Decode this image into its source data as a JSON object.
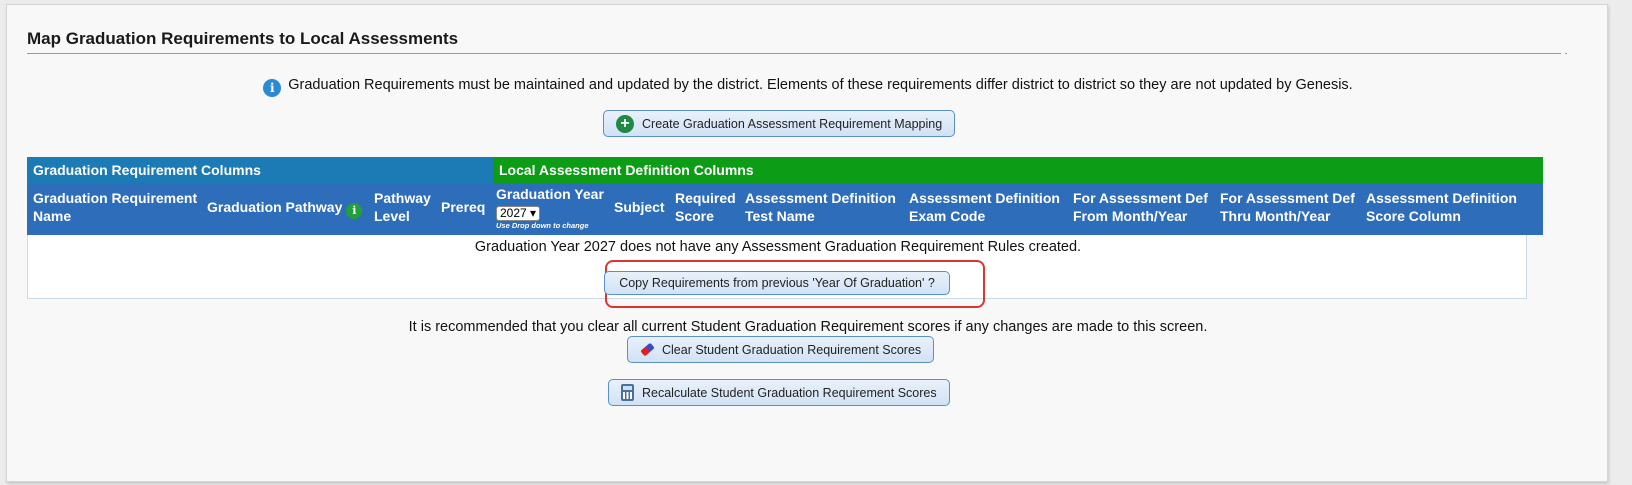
{
  "page": {
    "title": "Map Graduation Requirements to Local Assessments",
    "info_text": "Graduation Requirements must be maintained and updated by the district. Elements of these requirements differ district to district so they are not updated by Genesis."
  },
  "actions": {
    "create_mapping_label": "Create Graduation Assessment Requirement Mapping",
    "copy_requirements_label": "Copy Requirements from previous 'Year Of Graduation' ?",
    "clear_scores_label": "Clear Student Graduation Requirement Scores",
    "recalculate_scores_label": "Recalculate Student Graduation Requirement Scores"
  },
  "table": {
    "section_left": "Graduation Requirement Columns",
    "section_right": "Local Assessment Definition Columns",
    "columns": {
      "req_name": [
        "Graduation Requirement",
        "Name"
      ],
      "pathway": "Graduation Pathway",
      "pathway_level": [
        "Pathway",
        "Level"
      ],
      "prereq": "Prereq",
      "grad_year": "Graduation Year",
      "grad_year_value": "2027",
      "grad_year_hint": "Use Drop down to change",
      "subject": "Subject",
      "required_score": [
        "Required",
        "Score"
      ],
      "test_name": [
        "Assessment Definition",
        "Test Name"
      ],
      "exam_code": [
        "Assessment Definition",
        "Exam Code"
      ],
      "from_month_year": [
        "For Assessment Def",
        "From Month/Year"
      ],
      "thru_month_year": [
        "For Assessment Def",
        "Thru Month/Year"
      ],
      "score_column": [
        "Assessment Definition",
        "Score Column"
      ]
    },
    "empty_message": "Graduation Year 2027 does not have any Assessment Graduation Requirement Rules created."
  },
  "footer": {
    "recommendation": "It is recommended that you clear all current Student Graduation Requirement scores if any changes are made to this screen."
  },
  "colors": {
    "section_left_bg": "#1c7ab5",
    "section_right_bg": "#0d9c16",
    "header_bg": "#2d6dba",
    "highlight": "#d9372e"
  },
  "icons": [
    "info-icon",
    "plus-circle-icon",
    "info-green-icon",
    "eraser-icon",
    "calculator-icon"
  ]
}
